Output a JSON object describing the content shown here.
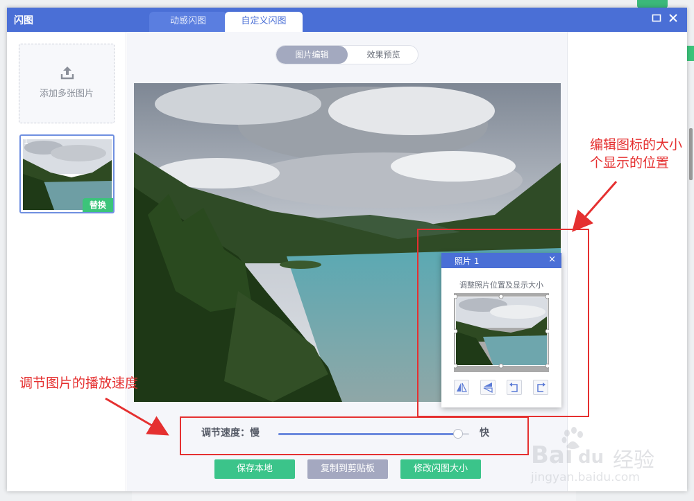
{
  "window": {
    "title": "闪图",
    "tabs": [
      {
        "label": "动感闪图",
        "active": false
      },
      {
        "label": "自定义闪图",
        "active": true
      }
    ],
    "maximize_icon": "maximize-icon",
    "close_icon": "close-icon"
  },
  "sidebar": {
    "add_label": "添加多张图片",
    "thumb_number": "1",
    "replace_label": "替换"
  },
  "main": {
    "segment": [
      {
        "label": "图片编辑",
        "active": true
      },
      {
        "label": "效果预览",
        "active": false
      }
    ],
    "speed": {
      "label": "调节速度：慢",
      "fast_label": "快",
      "value": 0.94
    },
    "buttons": {
      "save": "保存本地",
      "copy": "复制到剪贴板",
      "resize": "修改闪图大小"
    }
  },
  "dialog": {
    "title": "照片 1",
    "close": "×",
    "hint": "调整照片位置及显示大小",
    "tools": [
      "flip-horizontal-icon",
      "flip-vertical-icon",
      "rotate-left-icon",
      "rotate-right-icon"
    ]
  },
  "annotations": {
    "top_right": [
      "编辑图标的大小",
      "个显示的位置"
    ],
    "bottom_left": "调节图片的播放速度"
  },
  "watermark": {
    "brand": "Bai",
    "brand2": "du",
    "suffix": "经验",
    "url": "jingyan.baidu.com"
  },
  "colors": {
    "titlebar": "#4a6fd6",
    "green": "#3bc48a",
    "annotation_red": "#e53030"
  }
}
